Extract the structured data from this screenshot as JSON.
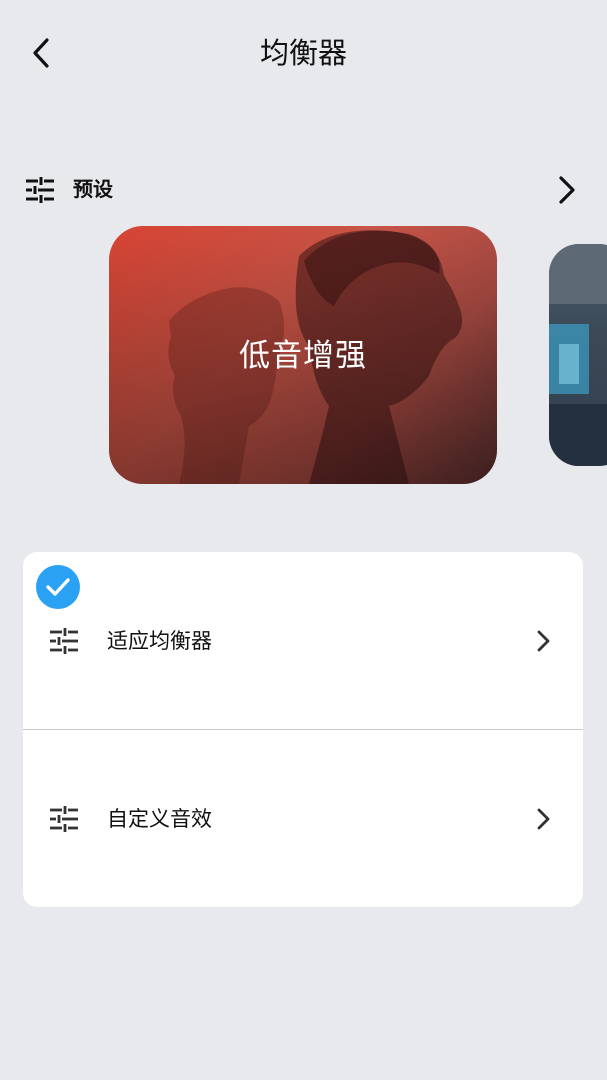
{
  "header": {
    "title": "均衡器",
    "back_icon": "chevron-left-icon"
  },
  "preset_section": {
    "icon": "sliders-icon",
    "label": "预设",
    "more_icon": "chevron-right-icon"
  },
  "carousel": {
    "cards": [
      {
        "label": "低音增强",
        "selected": true
      },
      {
        "label": ""
      }
    ]
  },
  "options": [
    {
      "icon": "sliders-icon",
      "label": "适应均衡器",
      "selected": true,
      "check_color": "#2aa1f3"
    },
    {
      "icon": "sliders-icon",
      "label": "自定义音效",
      "selected": false
    }
  ],
  "colors": {
    "background": "#e8e9ed",
    "accent": "#2aa1f3"
  }
}
